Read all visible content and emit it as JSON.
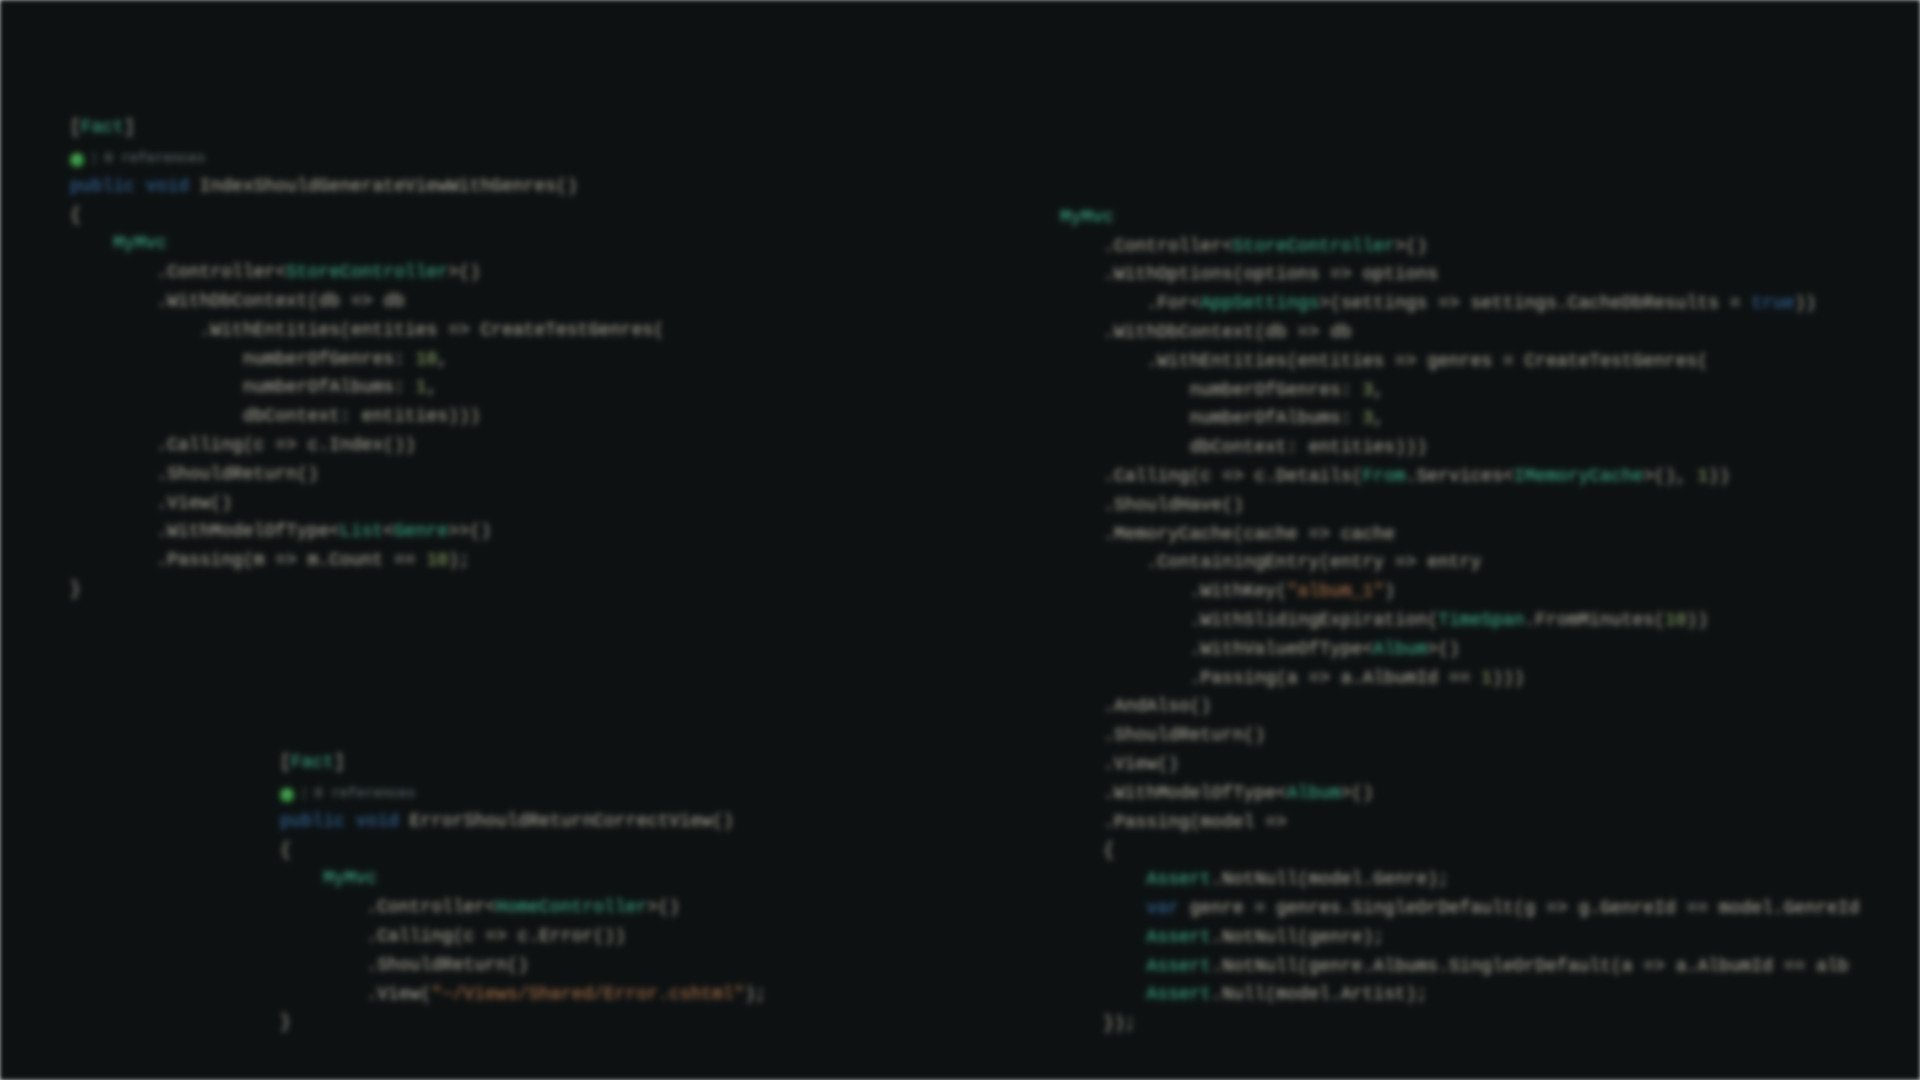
{
  "codelens": {
    "references_label": "0 references",
    "separator": "|",
    "check_glyph": "✓"
  },
  "blocks": {
    "a": {
      "attr_open": "[",
      "attr_name": "Fact",
      "attr_close": "]",
      "modifiers": "public",
      "returnType": "void",
      "methodName": "IndexShouldGenerateViewWithGenres",
      "methodParens": "()",
      "open_brace": "{",
      "mymvc": "MyMvc",
      "controller_call": ".Controller<",
      "controller_type": "StoreController",
      "controller_close": ">()",
      "with_db": ".WithDbContext(db => db",
      "with_entities": ".WithEntities(entities => CreateTestGenres(",
      "num_genres_label": "numberOfGenres: ",
      "num_genres_val": "10",
      "num_albums_label": "numberOfAlbums: ",
      "num_albums_val": "1",
      "db_context_label": "dbContext: entities)))",
      "calling": ".Calling(c => c.Index())",
      "should_return": ".ShouldReturn()",
      "view": ".View()",
      "with_model": ".WithModelOfType<",
      "list_type": "List",
      "genre_type": "Genre",
      "with_model_close": ">()",
      "passing": ".Passing(m => m.Count == ",
      "passing_val": "10",
      "passing_close": ");",
      "close_brace": "}"
    },
    "b": {
      "attr_open": "[",
      "attr_name": "Fact",
      "attr_close": "]",
      "modifiers": "public",
      "returnType": "void",
      "methodName": "ErrorShouldReturnCorrectView",
      "methodParens": "()",
      "open_brace": "{",
      "mymvc": "MyMvc",
      "controller_call": ".Controller<",
      "controller_type": "HomeController",
      "controller_close": ">()",
      "calling": ".Calling(c => c.Error())",
      "should_return": ".ShouldReturn()",
      "view": ".View(",
      "view_path": "\"~/Views/Shared/Error.cshtml\"",
      "view_close": ");",
      "close_brace": "}"
    },
    "c": {
      "mymvc": "MyMvc",
      "controller_call": ".Controller<",
      "controller_type": "StoreController",
      "controller_close": ">()",
      "with_options": ".WithOptions(options => options",
      "for_open": ".For<",
      "app_settings": "AppSettings",
      "for_close": ">(settings => settings.CacheDbResults = ",
      "true_kw": "true",
      "for_end": "))",
      "with_db": ".WithDbContext(db => db",
      "with_entities": ".WithEntities(entities => genres = CreateTestGenres(",
      "num_genres_label": "numberOfGenres: ",
      "num_genres_val": "3",
      "num_albums_label": "numberOfAlbums: ",
      "num_albums_val": "3",
      "db_context_label": "dbContext: entities)))",
      "calling_open": ".Calling(c => c.Details(",
      "from_type": "From",
      "services_text": ".Services<",
      "imemcache": "IMemoryCache",
      "services_close": ">(), ",
      "calling_arg": "1",
      "calling_close": "))",
      "should_have": ".ShouldHave()",
      "memory_cache": ".MemoryCache(cache => cache",
      "containing_entry": ".ContainingEntry(entry => entry",
      "with_key": ".WithKey(",
      "key_str": "\"album_1\"",
      "with_key_close": ")",
      "with_sliding": ".WithSlidingExpiration(",
      "timespan": "TimeSpan",
      "from_minutes": ".FromMinutes(",
      "minutes_val": "10",
      "from_minutes_close": "))",
      "with_value_of_type": ".WithValueOfType<",
      "album_type": "Album",
      "with_value_close": ">()",
      "passing1": ".Passing(a => a.AlbumId == ",
      "passing1_val": "1",
      "passing1_close": ")))",
      "and_also": ".AndAlso()",
      "should_return": ".ShouldReturn()",
      "view": ".View()",
      "with_model": ".WithModelOfType<",
      "with_model_close": ">()",
      "passing2": ".Passing(model =>",
      "open_brace2": "{",
      "assert": "Assert",
      "notnull1": ".NotNull(model.Genre);",
      "var_kw": "var",
      "genre_line": " genre = genres.SingleOrDefault(g => g.GenreId == model.GenreId",
      "notnull2": ".NotNull(genre);",
      "notnull3": ".NotNull(genre.Albums.SingleOrDefault(a => a.AlbumId == alb",
      "null1": ".Null(model.Artist);",
      "close2": "});"
    }
  }
}
